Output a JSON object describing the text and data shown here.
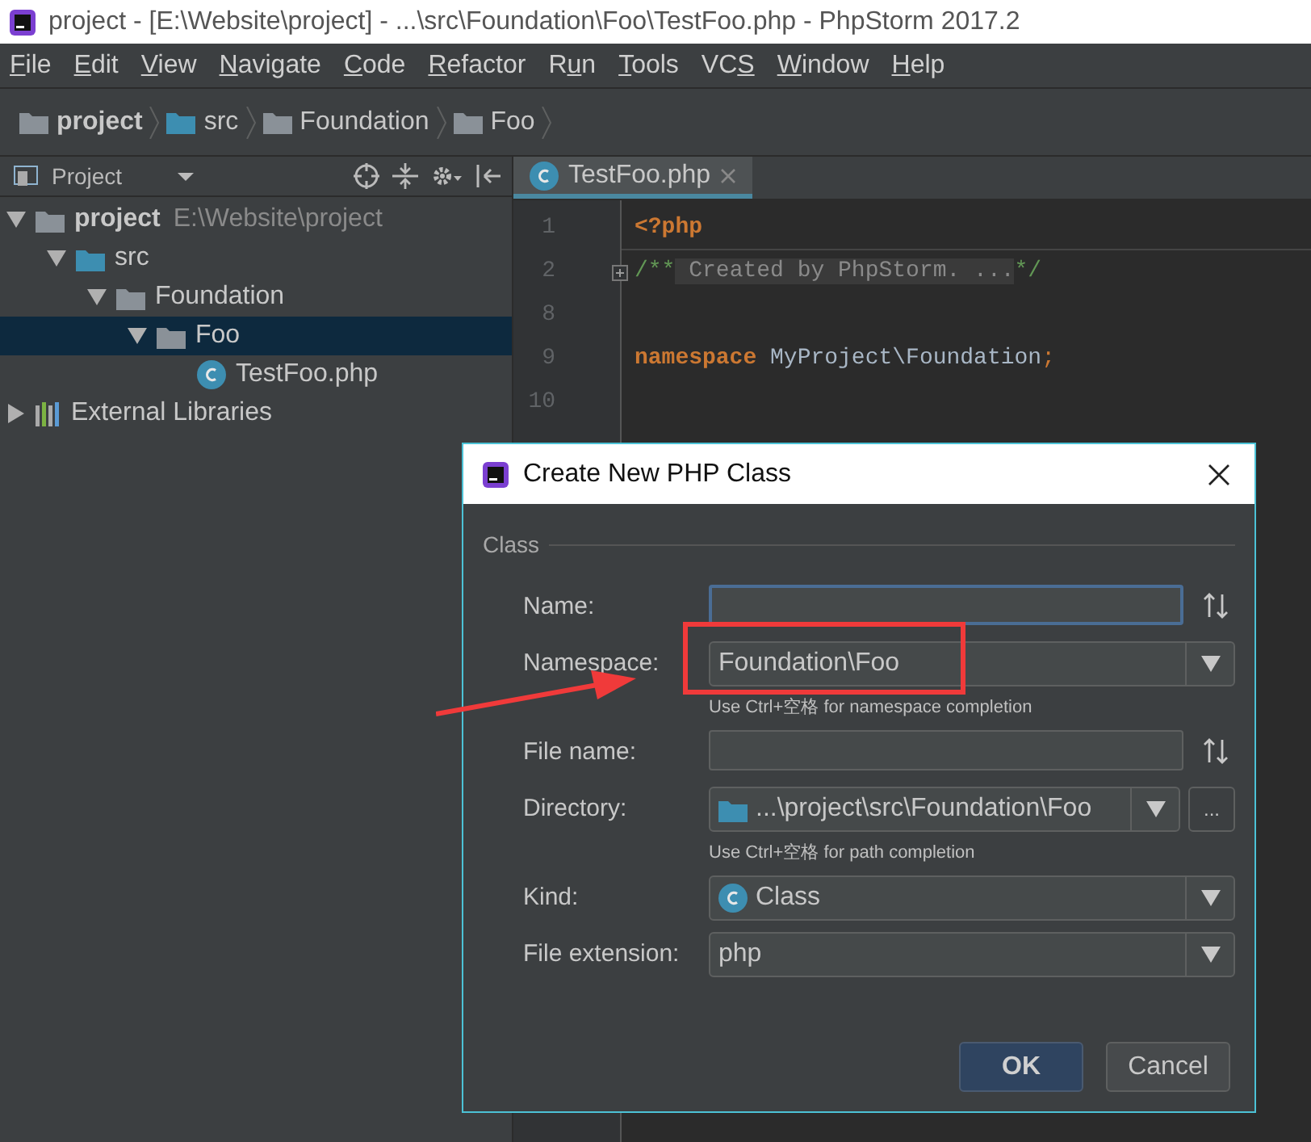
{
  "window": {
    "title": "project - [E:\\Website\\project] - ...\\src\\Foundation\\Foo\\TestFoo.php - PhpStorm 2017.2"
  },
  "menu": [
    {
      "key": "F",
      "after": "ile"
    },
    {
      "key": "E",
      "after": "dit"
    },
    {
      "key": "V",
      "after": "iew"
    },
    {
      "key": "N",
      "after": "avigate"
    },
    {
      "key": "C",
      "after": "ode"
    },
    {
      "key": "R",
      "after": "efactor"
    },
    {
      "before": "R",
      "key": "u",
      "after": "n"
    },
    {
      "key": "T",
      "after": "ools"
    },
    {
      "before": "VC",
      "key": "S"
    },
    {
      "key": "W",
      "after": "indow"
    },
    {
      "key": "H",
      "after": "elp"
    }
  ],
  "breadcrumbs": [
    {
      "label": "project",
      "kind": "root"
    },
    {
      "label": "src",
      "kind": "source"
    },
    {
      "label": "Foundation",
      "kind": "folder"
    },
    {
      "label": "Foo",
      "kind": "folder"
    }
  ],
  "project_panel": {
    "title": "Project",
    "tree": [
      {
        "label": "project",
        "path": "E:\\Website\\project",
        "kind": "root",
        "expanded": true,
        "selected": false,
        "children": [
          {
            "label": "src",
            "kind": "source",
            "expanded": true,
            "selected": false,
            "children": [
              {
                "label": "Foundation",
                "kind": "folder",
                "expanded": true,
                "selected": false,
                "children": [
                  {
                    "label": "Foo",
                    "kind": "folder",
                    "expanded": true,
                    "selected": true,
                    "children": [
                      {
                        "label": "TestFoo.php",
                        "kind": "class-file",
                        "selected": false
                      }
                    ]
                  }
                ]
              }
            ]
          }
        ]
      },
      {
        "label": "External Libraries",
        "kind": "libraries",
        "expanded": false,
        "selected": false
      }
    ]
  },
  "editor": {
    "tabs": [
      {
        "label": "TestFoo.php",
        "selected": true
      }
    ],
    "lines": [
      {
        "number": "1",
        "tokens": [
          {
            "text": "<?php",
            "kind": "keyword"
          }
        ]
      },
      {
        "number": "2",
        "folded": true,
        "tokens": [
          {
            "text": "/**",
            "kind": "comment"
          },
          {
            "text": " Created by PhpStorm. ...",
            "kind": "fold"
          },
          {
            "text": "*/",
            "kind": "comment"
          }
        ]
      },
      {
        "number": "8"
      },
      {
        "number": "9",
        "tokens": [
          {
            "text": "namespace",
            "kind": "keyword"
          },
          {
            "text": " MyProject\\Foundation",
            "kind": "plain"
          },
          {
            "text": ";",
            "kind": "punct"
          }
        ]
      },
      {
        "number": "10"
      }
    ]
  },
  "dialog": {
    "title": "Create New PHP Class",
    "section": "Class",
    "fields": [
      {
        "label": "Name:",
        "kind": "input",
        "focused": true
      },
      {
        "label": "Namespace:",
        "kind": "dropdown",
        "value": "Foundation\\Foo",
        "hint": "Use Ctrl+空格 for namespace completion"
      },
      {
        "label": "File name:",
        "kind": "input",
        "focused": false
      },
      {
        "label": "Directory:",
        "kind": "directory",
        "value": "...\\project\\src\\Foundation\\Foo",
        "browse": "...",
        "hint": "Use Ctrl+空格 for path completion"
      },
      {
        "label": "Kind:",
        "kind": "class-select",
        "value": "Class"
      },
      {
        "label": "File extension:",
        "kind": "dropdown",
        "value": "php"
      }
    ],
    "buttons": [
      {
        "label": "OK",
        "default": true
      },
      {
        "label": "Cancel",
        "default": false
      }
    ]
  },
  "annotation": {
    "kind": "highlight-box-with-arrow"
  }
}
